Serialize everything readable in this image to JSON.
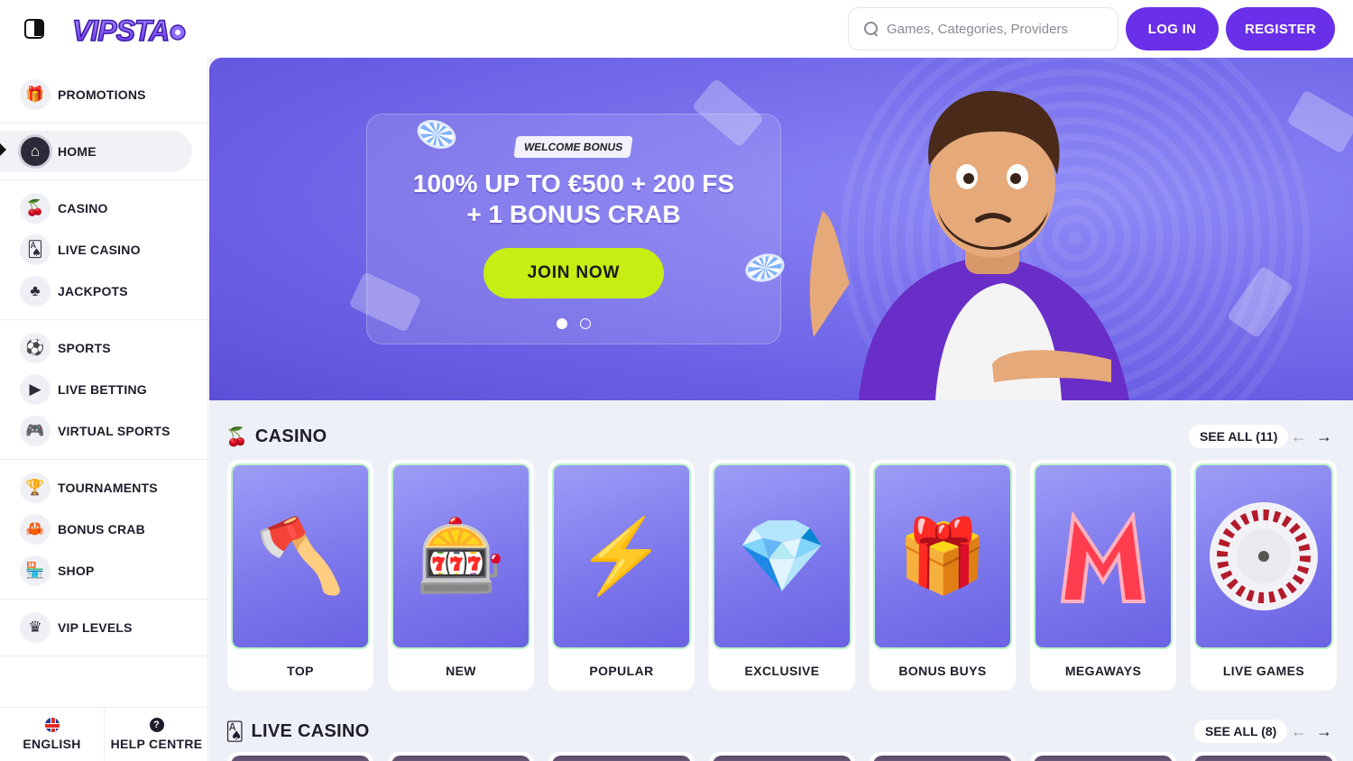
{
  "header": {
    "logo_text": "VIPSTA",
    "search_placeholder": "Games, Categories, Providers",
    "login_label": "LOG IN",
    "register_label": "REGISTER"
  },
  "sidebar": {
    "groups": [
      [
        {
          "label": "PROMOTIONS",
          "icon": "gift-icon"
        }
      ],
      [
        {
          "label": "HOME",
          "icon": "home-icon",
          "active": true
        }
      ],
      [
        {
          "label": "CASINO",
          "icon": "cherries-icon"
        },
        {
          "label": "LIVE CASINO",
          "icon": "cards-icon"
        },
        {
          "label": "JACKPOTS",
          "icon": "clover-icon"
        }
      ],
      [
        {
          "label": "SPORTS",
          "icon": "soccer-ball-icon"
        },
        {
          "label": "LIVE BETTING",
          "icon": "play-icon"
        },
        {
          "label": "VIRTUAL SPORTS",
          "icon": "gamepad-icon"
        }
      ],
      [
        {
          "label": "TOURNAMENTS",
          "icon": "trophy-icon"
        },
        {
          "label": "BONUS CRAB",
          "icon": "crab-icon"
        },
        {
          "label": "SHOP",
          "icon": "shop-icon"
        }
      ],
      [
        {
          "label": "VIP LEVELS",
          "icon": "crown-icon"
        }
      ]
    ],
    "footer": {
      "language_label": "ENGLISH",
      "help_label": "HELP CENTRE"
    }
  },
  "hero": {
    "badge": "WELCOME BONUS",
    "title_line1": "100% UP TO €500 + 200 FS",
    "title_line2": "+ 1 BONUS CRAB",
    "cta_label": "JOIN NOW",
    "slides": 2,
    "active_slide": 1
  },
  "casino": {
    "title": "CASINO",
    "see_all": "SEE ALL (11)",
    "tiles": [
      {
        "label": "TOP",
        "art": "viking"
      },
      {
        "label": "NEW",
        "art": "slot-machine"
      },
      {
        "label": "POPULAR",
        "art": "zeus"
      },
      {
        "label": "EXCLUSIVE",
        "art": "diamond-crown"
      },
      {
        "label": "BONUS BUYS",
        "art": "gift-box"
      },
      {
        "label": "MEGAWAYS",
        "art": "letter-m"
      },
      {
        "label": "LIVE GAMES",
        "art": "roulette"
      }
    ]
  },
  "live_casino": {
    "title": "LIVE CASINO",
    "see_all": "SEE ALL (8)"
  },
  "colors": {
    "accent": "#6a2fe8",
    "cta": "#c6ee12",
    "hero_bg": "#7b73ee",
    "tile_border": "#b9f3c6"
  }
}
